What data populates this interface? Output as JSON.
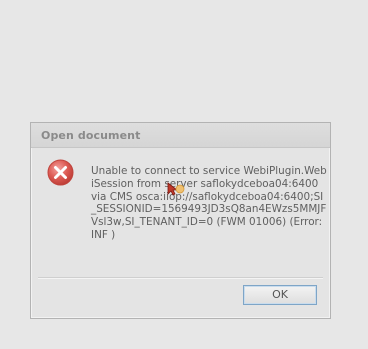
{
  "dialog": {
    "title": "Open document",
    "icon": "error-icon",
    "message": "Unable to connect to service WebiPlugin.WebiSession from server saflokydceboa04:6400 via CMS osca:iiop://saflokydceboa04:6400;SI_SESSIONID=1569493JD3sQ8an4EWzs5MMJFVsl3w,SI_TENANT_ID=0 (FWM 01006) (Error: INF )",
    "ok_label": "OK"
  },
  "colors": {
    "error_red": "#d9534a",
    "button_border": "#7ea5c7"
  }
}
